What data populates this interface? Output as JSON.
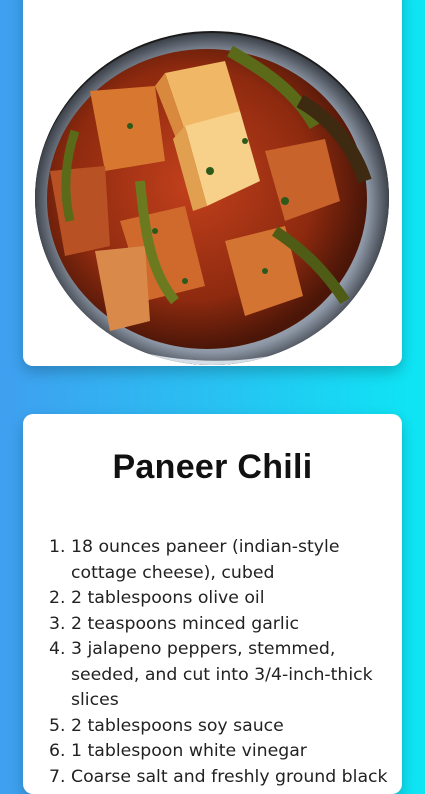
{
  "recipe": {
    "title": "Paneer Chili",
    "image_alt": "paneer-chili-photo",
    "ingredients": [
      {
        "num": "1.",
        "text": "18 ounces paneer (indian-style cottage cheese), cubed"
      },
      {
        "num": "2.",
        "text": "2 tablespoons olive oil"
      },
      {
        "num": "3.",
        "text": "2 teaspoons minced garlic"
      },
      {
        "num": "4.",
        "text": "3 jalapeno peppers, stemmed, seeded, and cut into 3/4-inch-thick slices"
      },
      {
        "num": "5.",
        "text": "2 tablespoons soy sauce"
      },
      {
        "num": "6.",
        "text": "1 tablespoon white vinegar"
      },
      {
        "num": "7.",
        "text": "Coarse salt and freshly ground black"
      }
    ]
  }
}
